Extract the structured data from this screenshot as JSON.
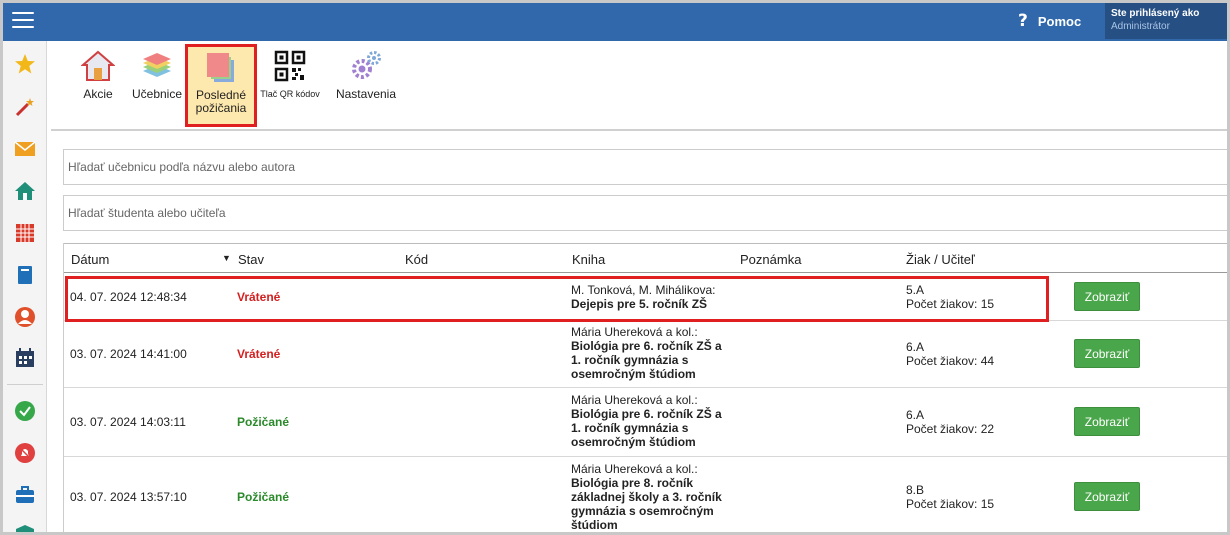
{
  "header": {
    "help_label": "Pomoc",
    "help_icon": "?",
    "user_line1": "Ste prihlásený ako",
    "user_line2": "Administrátor",
    "bar_color": "#3068ab"
  },
  "sidebar": {
    "icons": [
      "star-icon",
      "magic-wand-icon",
      "envelope-icon",
      "home-icon",
      "calendar-grid-icon",
      "book-icon",
      "person-icon",
      "schedule-icon",
      "check-circle-icon",
      "bell-off-icon",
      "briefcase-icon",
      "shield-icon"
    ]
  },
  "toolbar": {
    "items": [
      {
        "label": "Akcie",
        "icon": "house-door-icon"
      },
      {
        "label": "Učebnice",
        "icon": "book-stack-icon"
      },
      {
        "label": "Posledné požičania",
        "icon": "recent-loans-icon"
      },
      {
        "label": "Tlač QR kódov",
        "icon": "qr-code-icon"
      },
      {
        "label": "Nastavenia",
        "icon": "gears-icon"
      }
    ]
  },
  "search": {
    "book_placeholder": "Hľadať učebnicu podľa názvu alebo autora",
    "student_placeholder": "Hľadať študenta alebo učiteľa"
  },
  "table": {
    "columns": [
      "Dátum",
      "Stav",
      "Kód",
      "Kniha",
      "Poznámka",
      "Žiak / Učiteľ"
    ],
    "sort_indicator": "▼",
    "button_label": "Zobraziť",
    "rows": [
      {
        "date": "04. 07. 2024 12:48:34",
        "status": "Vrátené",
        "status_type": "returned",
        "author": "M. Tonková, M. Mihálikova:",
        "title": "Dejepis pre 5. ročník ZŠ",
        "class": "5.A",
        "count": "Počet žiakov: 15"
      },
      {
        "date": "03. 07. 2024 14:41:00",
        "status": "Vrátené",
        "status_type": "returned",
        "author": "Mária Uhereková a kol.:",
        "title": "Biológia pre 6. ročník ZŠ a 1. ročník gymnázia s osemročným štúdiom",
        "class": "6.A",
        "count": "Počet žiakov: 44"
      },
      {
        "date": "03. 07. 2024 14:03:11",
        "status": "Požičané",
        "status_type": "loaned",
        "author": "Mária Uhereková a kol.:",
        "title": "Biológia pre 6. ročník ZŠ a 1. ročník gymnázia s osemročným štúdiom",
        "class": "6.A",
        "count": "Počet žiakov: 22"
      },
      {
        "date": "03. 07. 2024 13:57:10",
        "status": "Požičané",
        "status_type": "loaned",
        "author": "Mária Uhereková a kol.:",
        "title": "Biológia pre 8. ročník základnej školy a 3. ročník gymnázia s osemročným štúdiom",
        "class": "8.B",
        "count": "Počet žiakov: 15"
      }
    ]
  },
  "colors": {
    "returned": "#d42020",
    "loaned": "#2a8a2a",
    "button": "#4aa64a",
    "highlight": "#e02020"
  }
}
